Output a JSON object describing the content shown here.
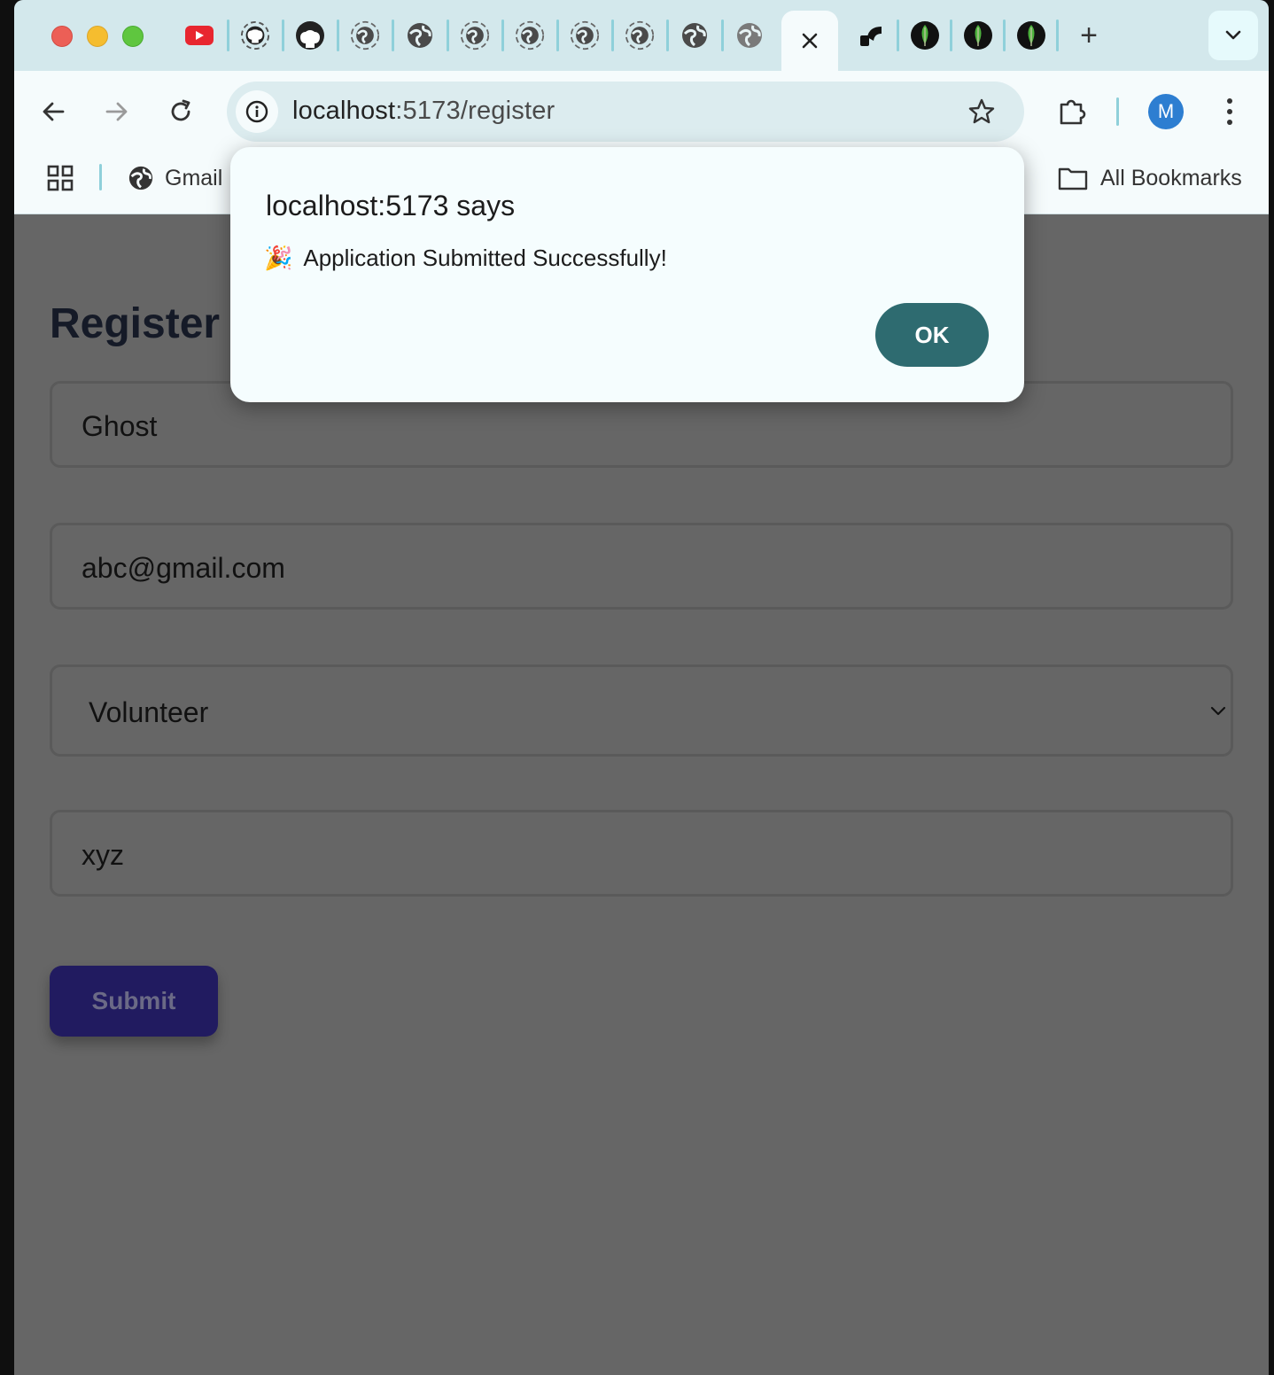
{
  "browser": {
    "tabs": [
      {
        "icon": "youtube-icon"
      },
      {
        "icon": "github-icon"
      },
      {
        "icon": "github-icon"
      },
      {
        "icon": "globe-loading-icon"
      },
      {
        "icon": "globe-icon"
      },
      {
        "icon": "globe-loading-icon"
      },
      {
        "icon": "globe-loading-icon"
      },
      {
        "icon": "globe-loading-icon"
      },
      {
        "icon": "globe-loading-icon"
      },
      {
        "icon": "globe-icon"
      },
      {
        "icon": "globe-icon"
      },
      {
        "icon": "close-icon",
        "active": true
      },
      {
        "icon": "render-icon"
      },
      {
        "icon": "mongodb-leaf-icon"
      },
      {
        "icon": "mongodb-leaf-icon"
      },
      {
        "icon": "mongodb-leaf-icon"
      }
    ],
    "new_tab_label": "+",
    "url_host": "localhost",
    "url_path": ":5173/register",
    "profile_initial": "M",
    "bookmarks": {
      "gmail": "Gmail",
      "all": "All Bookmarks"
    },
    "colors": {
      "tabstrip": "#d3e8ec",
      "toolbar": "#f5fbfc",
      "avatar": "#2d7ed1"
    }
  },
  "page": {
    "title": "Register",
    "fields": {
      "name": "Ghost",
      "email": "abc@gmail.com",
      "role": "Volunteer",
      "extra": "xyz"
    },
    "submit_label": "Submit",
    "colors": {
      "submit_bg": "#211b60",
      "overlay": "#666666"
    }
  },
  "dialog": {
    "title": "localhost:5173 says",
    "emoji": "🎉",
    "message": "Application Submitted Successfully!",
    "ok_label": "OK",
    "colors": {
      "ok_bg": "#2e6b70"
    }
  }
}
